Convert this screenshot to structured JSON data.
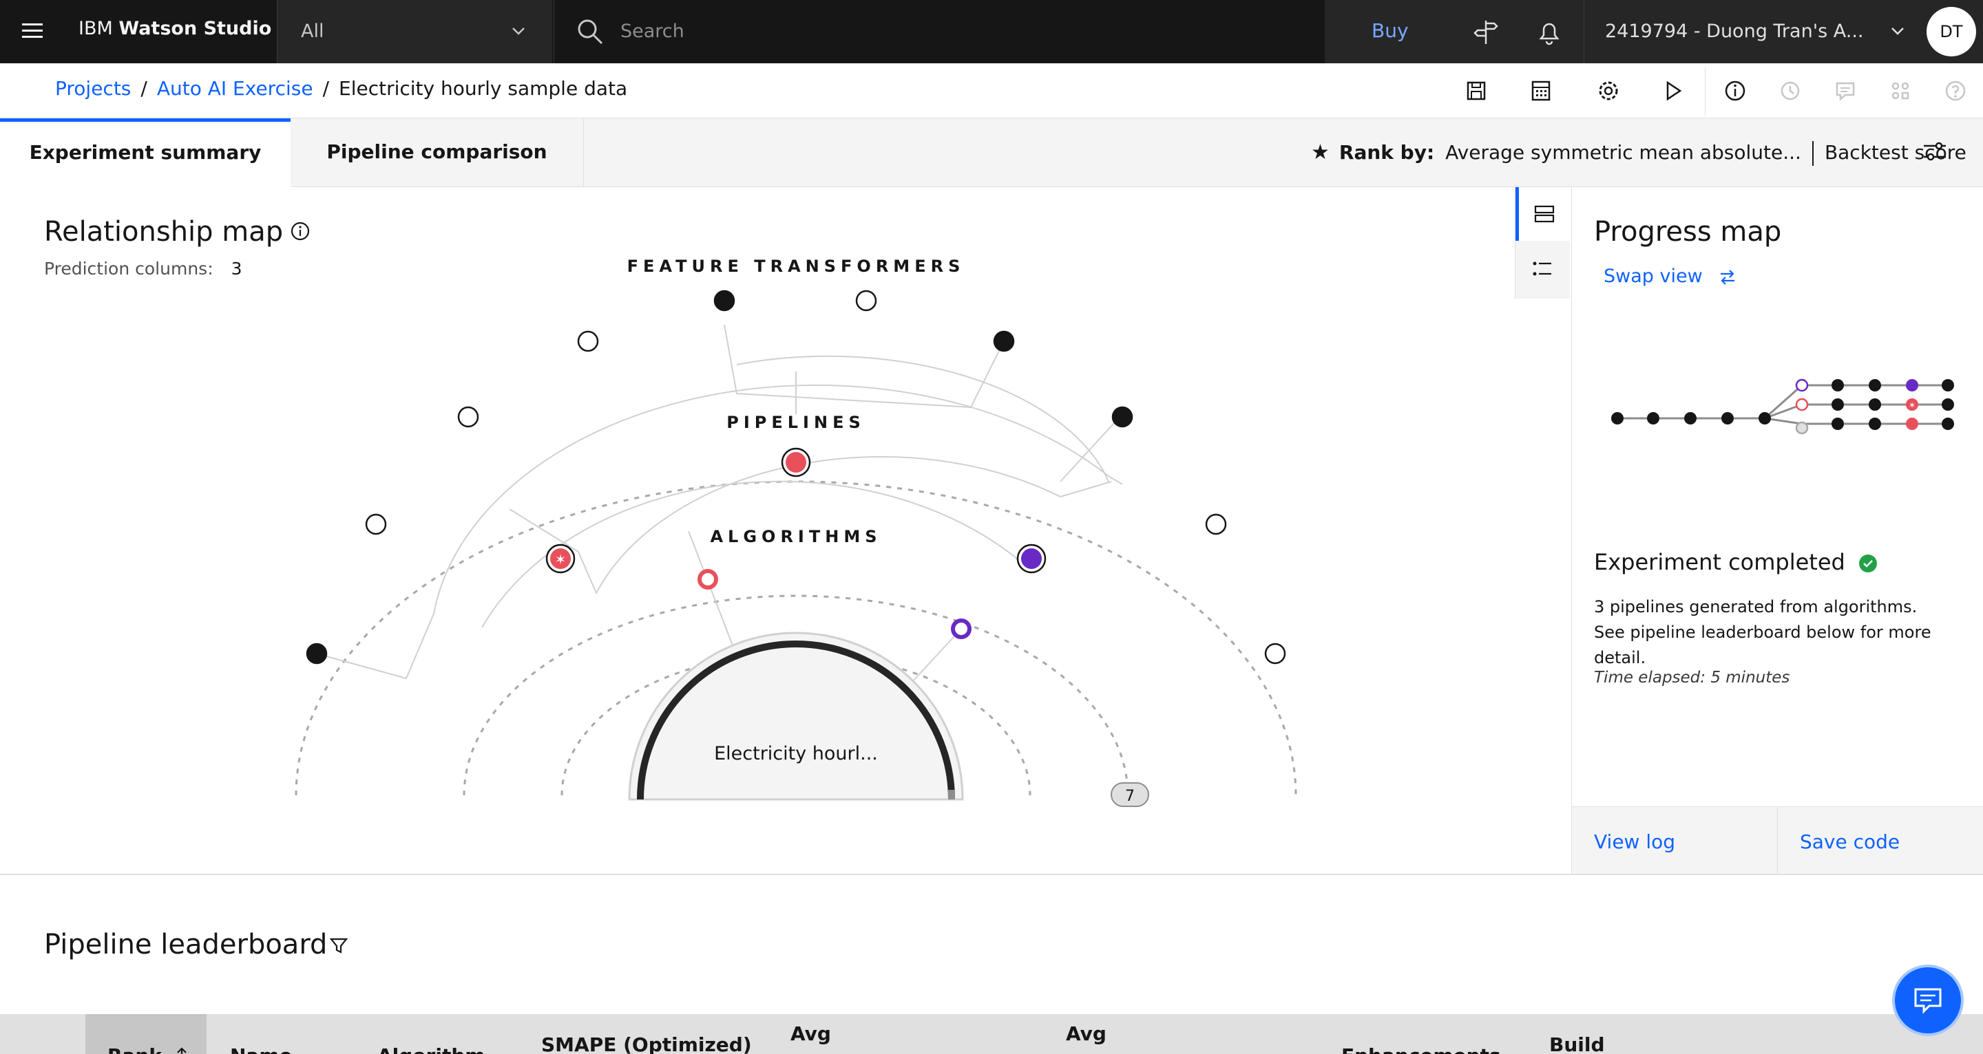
{
  "header": {
    "brand_prefix": "IBM",
    "brand_name": "Watson Studio",
    "scope_label": "All",
    "search_placeholder": "Search",
    "buy_label": "Buy",
    "account_label": "2419794 - Duong Tran's A...",
    "avatar_initials": "DT"
  },
  "breadcrumb": {
    "items": [
      "Projects",
      "Auto AI Exercise"
    ],
    "current": "Electricity hourly sample data",
    "separator": "/"
  },
  "tabs": [
    {
      "label": "Experiment summary",
      "active": true
    },
    {
      "label": "Pipeline comparison",
      "active": false
    }
  ],
  "rank_by": {
    "star": "★",
    "label": "Rank by:",
    "metric": "Average symmetric mean absolute...",
    "score_type": "Backtest score"
  },
  "relationship_map": {
    "title": "Relationship map",
    "prediction_columns_label": "Prediction columns:",
    "prediction_columns_value": "3",
    "ring_labels": {
      "feature_transformers": "FEATURE TRANSFORMERS",
      "pipelines": "PIPELINES",
      "algorithms": "ALGORITHMS"
    },
    "center_label": "Electricity hourl...",
    "badge_count": "7"
  },
  "progress_map": {
    "title": "Progress map",
    "swap_label": "Swap view",
    "status_title": "Experiment completed",
    "description": "3 pipelines generated from algorithms. See pipeline leaderboard below for more detail.",
    "elapsed": "Time elapsed: 5 minutes",
    "view_log": "View log",
    "save_code": "Save code"
  },
  "leaderboard": {
    "title": "Pipeline leaderboard",
    "columns": [
      {
        "label": "Rank"
      },
      {
        "label": "Name"
      },
      {
        "label": "Algorithm"
      },
      {
        "label": "SMAPE (Optimized)"
      },
      {
        "label": "Avg"
      },
      {
        "label": "Avg"
      },
      {
        "label": "Enhancements"
      },
      {
        "label": "Build"
      }
    ]
  },
  "colors": {
    "accent": "#0f62fe",
    "header_bg": "#161616",
    "pipeline_red": "#e8505b",
    "pipeline_purple": "#6929c4",
    "success": "#24a148"
  }
}
